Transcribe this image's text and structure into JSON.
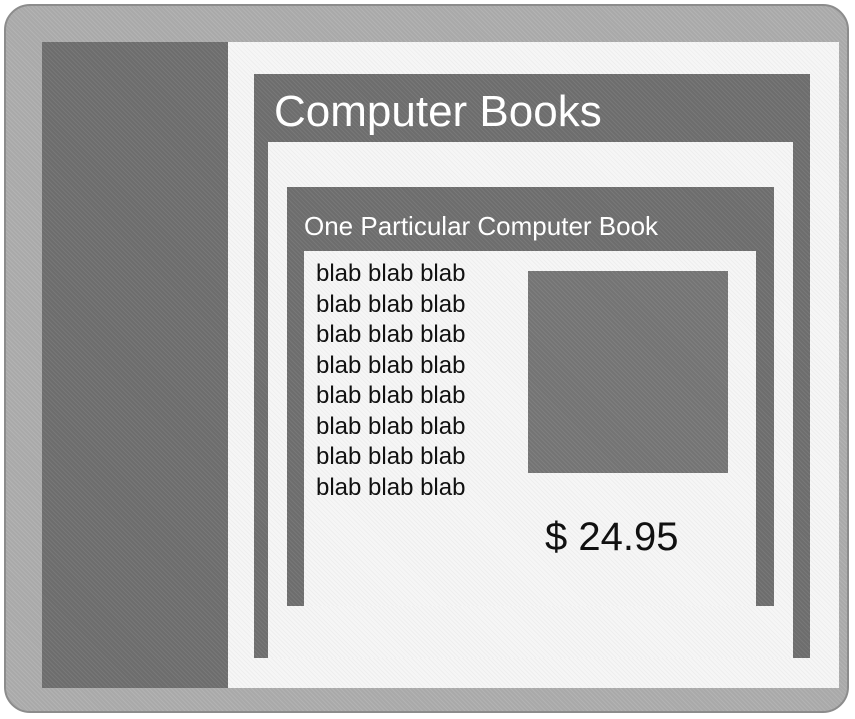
{
  "category": {
    "title": "Computer Books"
  },
  "book": {
    "title": "One Particular Computer Book",
    "description_lines": [
      "blab blab blab",
      "blab blab blab",
      "blab blab blab",
      "blab blab blab",
      "blab blab blab",
      "blab blab blab",
      "blab blab blab",
      "blab blab blab"
    ],
    "price": "$ 24.95",
    "cover_image": "book-cover-placeholder"
  }
}
